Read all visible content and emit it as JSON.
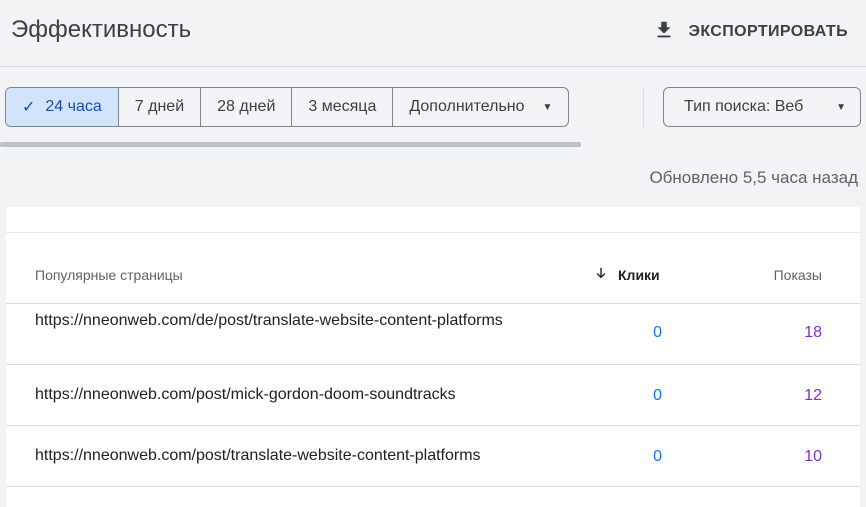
{
  "header": {
    "title": "Эффективность",
    "export_label": "ЭКСПОРТИРОВАТЬ",
    "export_icon": "download-icon"
  },
  "date_filters": {
    "selected": "24 часа",
    "chips": [
      "24 часа",
      "7 дней",
      "28 дней",
      "3 месяца",
      "Дополнительно"
    ]
  },
  "search_type": {
    "label": "Тип поиска: Веб"
  },
  "updated_text": "Обновлено 5,5 часа назад",
  "table": {
    "col_pages": "Популярные страницы",
    "col_clicks": "Клики",
    "col_impressions": "Показы",
    "sort": "clicks-desc",
    "rows": [
      {
        "url": "https://nneonweb.com/de/post/translate-website-content-platforms",
        "clicks": "0",
        "impressions": "18"
      },
      {
        "url": "https://nneonweb.com/post/mick-gordon-doom-soundtracks",
        "clicks": "0",
        "impressions": "12"
      },
      {
        "url": "https://nneonweb.com/post/translate-website-content-platforms",
        "clicks": "0",
        "impressions": "10"
      }
    ]
  },
  "colors": {
    "selected_chip_bg": "#d2e3fc",
    "clicks": "#1a73e8",
    "impressions": "#8430ce"
  }
}
